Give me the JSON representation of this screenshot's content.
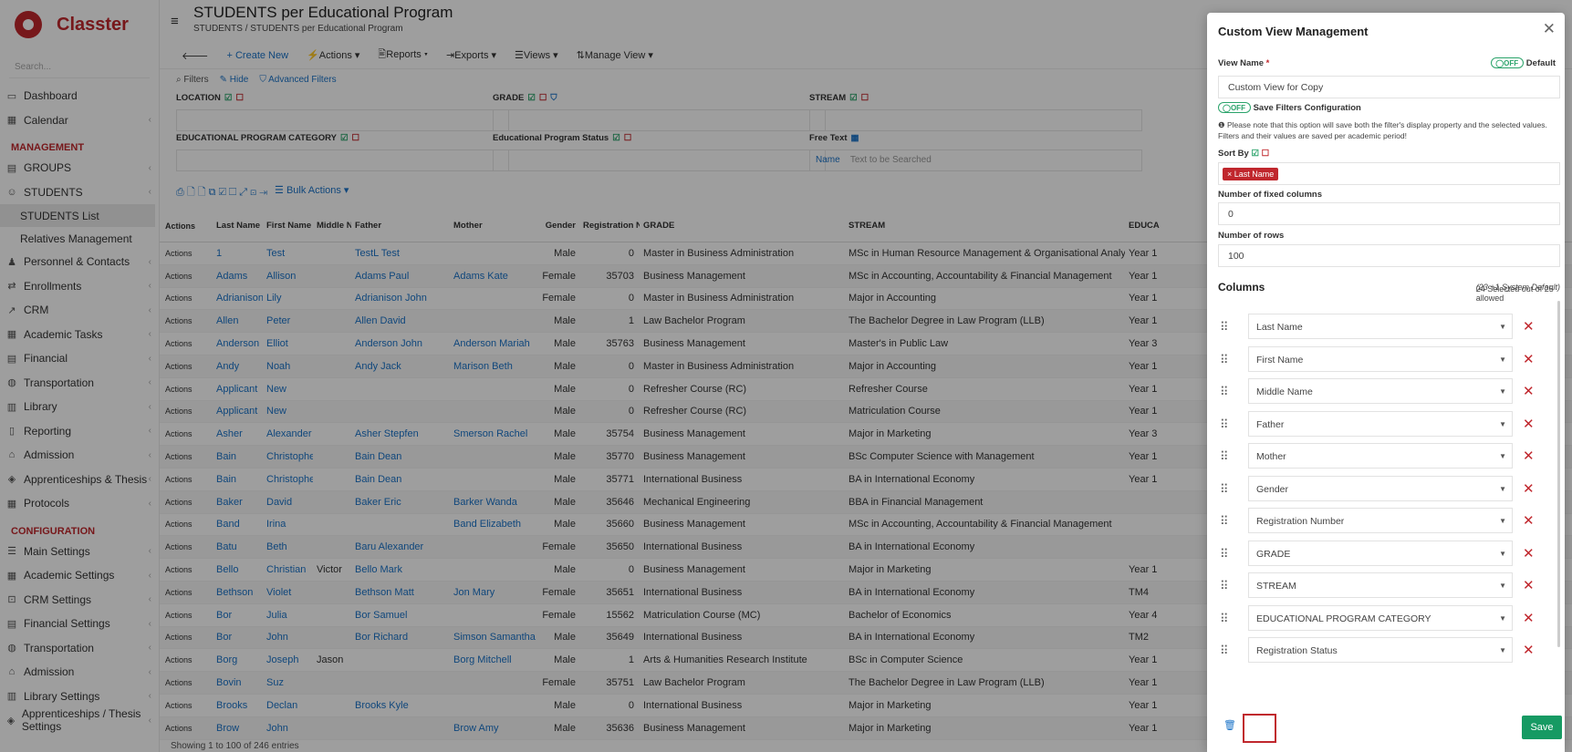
{
  "sidebar": {
    "brand": "Classter",
    "search_placeholder": "Search...",
    "top": [
      {
        "label": "Dashboard",
        "icon": "monitor-icon"
      },
      {
        "label": "Calendar",
        "icon": "calendar-icon"
      }
    ],
    "mgmt_title": "MANAGEMENT",
    "mgmt": [
      {
        "label": "GROUPS",
        "icon": "groups-icon"
      },
      {
        "label": "STUDENTS",
        "icon": "students-icon"
      }
    ],
    "students_sub": [
      {
        "label": "STUDENTS List"
      },
      {
        "label": "Relatives Management"
      }
    ],
    "mgmt2": [
      {
        "label": "Personnel & Contacts",
        "icon": "people-icon"
      },
      {
        "label": "Enrollments",
        "icon": "arrows-icon"
      },
      {
        "label": "CRM",
        "icon": "chart-icon"
      },
      {
        "label": "Academic Tasks",
        "icon": "grid-icon"
      },
      {
        "label": "Financial",
        "icon": "money-icon"
      },
      {
        "label": "Transportation",
        "icon": "bus-icon"
      },
      {
        "label": "Library",
        "icon": "library-icon"
      },
      {
        "label": "Reporting",
        "icon": "report-icon"
      },
      {
        "label": "Admission",
        "icon": "bank-icon"
      },
      {
        "label": "Apprenticeships & Thesis",
        "icon": "cap-icon"
      },
      {
        "label": "Protocols",
        "icon": "protocol-icon"
      }
    ],
    "config_title": "CONFIGURATION",
    "config": [
      {
        "label": "Main Settings",
        "icon": "sliders-icon"
      },
      {
        "label": "Academic Settings",
        "icon": "grid-icon"
      },
      {
        "label": "CRM Settings",
        "icon": "crm-icon"
      },
      {
        "label": "Financial Settings",
        "icon": "money-icon"
      },
      {
        "label": "Transportation",
        "icon": "bus-icon"
      },
      {
        "label": "Admission",
        "icon": "bank-icon"
      },
      {
        "label": "Library Settings",
        "icon": "library-icon"
      },
      {
        "label": "Apprenticeships / Thesis Settings",
        "icon": "cap-icon"
      }
    ]
  },
  "page": {
    "title": "STUDENTS per Educational Program",
    "crumb1": "STUDENTS",
    "crumb_sep": "/",
    "crumb2": "STUDENTS per Educational Program"
  },
  "toolbar": {
    "create": "Create New",
    "actions": "Actions",
    "reports": "Reports",
    "exports": "Exports",
    "views": "Views",
    "manage": "Manage View"
  },
  "filters": {
    "filters": "Filters",
    "hide": "Hide",
    "advanced": "Advanced Filters",
    "location": "LOCATION",
    "grade": "GRADE",
    "stream": "STREAM",
    "epc": "EDUCATIONAL PROGRAM CATEGORY",
    "eps": "Educational Program Status",
    "free": "Free Text",
    "name": "Name",
    "search_ph": "Text to be Searched",
    "bulk": "Bulk Actions"
  },
  "table": {
    "headers": [
      "Actions",
      "Last Name",
      "First Name",
      "Middle Name",
      "Father",
      "Mother",
      "Gender",
      "Registration Number",
      "GRADE",
      "STREAM",
      "EDUCA PROGR CATEG"
    ],
    "rows": [
      [
        "Actions",
        "1",
        "Test",
        "",
        "TestL Test",
        "",
        "Male",
        "0",
        "Master in Business Administration",
        "MSc in Human Resource Management & Organisational Analysis",
        "Year 1"
      ],
      [
        "Actions",
        "Adams",
        "Allison",
        "",
        "Adams Paul",
        "Adams Kate",
        "Female",
        "35703",
        "Business Management",
        "MSc in Accounting, Accountability & Financial Management",
        "Year 1"
      ],
      [
        "Actions",
        "Adrianison",
        "Lily",
        "",
        "Adrianison John",
        "",
        "Female",
        "0",
        "Master in Business Administration",
        "Major in Accounting",
        "Year 1"
      ],
      [
        "Actions",
        "Allen",
        "Peter",
        "",
        "Allen David",
        "",
        "Male",
        "1",
        "Law Bachelor Program",
        "The Bachelor Degree in Law Program (LLB)",
        "Year 1"
      ],
      [
        "Actions",
        "Anderson",
        "Elliot",
        "",
        "Anderson John",
        "Anderson Mariah",
        "Male",
        "35763",
        "Business Management",
        "Master's in Public Law",
        "Year 3"
      ],
      [
        "Actions",
        "Andy",
        "Noah",
        "",
        "Andy Jack",
        "Marison Beth",
        "Male",
        "0",
        "Master in Business Administration",
        "Major in Accounting",
        "Year 1"
      ],
      [
        "Actions",
        "Applicant",
        "New",
        "",
        "",
        "",
        "Male",
        "0",
        "Refresher Course (RC)",
        "Refresher Course",
        "Year 1"
      ],
      [
        "Actions",
        "Applicant",
        "New",
        "",
        "",
        "",
        "Male",
        "0",
        "Refresher Course (RC)",
        "Matriculation Course",
        "Year 1"
      ],
      [
        "Actions",
        "Asher",
        "Alexander",
        "",
        "Asher Stepfen",
        "Smerson Rachel",
        "Male",
        "35754",
        "Business Management",
        "Major in Marketing",
        "Year 3"
      ],
      [
        "Actions",
        "Bain",
        "Christopher",
        "",
        "Bain Dean",
        "",
        "Male",
        "35770",
        "Business Management",
        "BSc Computer Science with Management",
        "Year 1"
      ],
      [
        "Actions",
        "Bain",
        "Christopher",
        "",
        "Bain Dean",
        "",
        "Male",
        "35771",
        "International Business",
        "BA in International Economy",
        "Year 1"
      ],
      [
        "Actions",
        "Baker",
        "David",
        "",
        "Baker Eric",
        "Barker Wanda",
        "Male",
        "35646",
        "Mechanical Engineering",
        "BBA in Financial Management",
        ""
      ],
      [
        "Actions",
        "Band",
        "Irina",
        "",
        "",
        "Band Elizabeth",
        "Male",
        "35660",
        "Business Management",
        "MSc in Accounting, Accountability & Financial Management",
        ""
      ],
      [
        "Actions",
        "Batu",
        "Beth",
        "",
        "Baru Alexander",
        "",
        "Female",
        "35650",
        "International Business",
        "BA in International Economy",
        ""
      ],
      [
        "Actions",
        "Bello",
        "Christian",
        "Victor",
        "Bello Mark",
        "",
        "Male",
        "0",
        "Business Management",
        "Major in Marketing",
        "Year 1"
      ],
      [
        "Actions",
        "Bethson",
        "Violet",
        "",
        "Bethson Matt",
        "Jon Mary",
        "Female",
        "35651",
        "International Business",
        "BA in International Economy",
        "TM4"
      ],
      [
        "Actions",
        "Bor",
        "Julia",
        "",
        "Bor Samuel",
        "",
        "Female",
        "15562",
        "Matriculation Course (MC)",
        "Bachelor of Economics",
        "Year 4"
      ],
      [
        "Actions",
        "Bor",
        "John",
        "",
        "Bor Richard",
        "Simson Samantha",
        "Male",
        "35649",
        "International Business",
        "BA in International Economy",
        "TM2"
      ],
      [
        "Actions",
        "Borg",
        "Joseph",
        "Jason",
        "",
        "Borg Mitchell",
        "Male",
        "1",
        "Arts & Humanities Research Institute",
        "BSc in Computer Science",
        "Year 1"
      ],
      [
        "Actions",
        "Bovin",
        "Suz",
        "",
        "",
        "",
        "Female",
        "35751",
        "Law Bachelor Program",
        "The Bachelor Degree in Law Program (LLB)",
        "Year 1"
      ],
      [
        "Actions",
        "Brooks",
        "Declan",
        "",
        "Brooks Kyle",
        "",
        "Male",
        "0",
        "International Business",
        "Major in Marketing",
        "Year 1"
      ],
      [
        "Actions",
        "Brow",
        "John",
        "",
        "",
        "Brow Amy",
        "Male",
        "35636",
        "Business Management",
        "Major in Marketing",
        "Year 1"
      ]
    ]
  },
  "footer": "Showing 1 to 100 of 246 entries",
  "modal": {
    "title": "Custom View Management",
    "view_name_label": "View Name",
    "required": "*",
    "off": "OFF",
    "default": "Default",
    "view_name_value": "Custom View for Copy",
    "save_filters": "Save Filters Configuration",
    "note": "Please note that this option will save both the filter's display property and the selected values. Filters and their values are saved per academic period!",
    "sort_by": "Sort By",
    "sort_chip": "× Last Name",
    "fixed_label": "Number of fixed columns",
    "fixed_value": "0",
    "rows_label": "Number of rows",
    "rows_value": "100",
    "columns": "Columns",
    "selected_info": "24 Selected out of 25 allowed",
    "selected_extra": "(23 +1 System Default)",
    "cols": [
      "Last Name",
      "First Name",
      "Middle Name",
      "Father",
      "Mother",
      "Gender",
      "Registration Number",
      "GRADE",
      "STREAM",
      "EDUCATIONAL PROGRAM CATEGORY",
      "Registration Status"
    ],
    "save": "Save"
  },
  "colors": {
    "brand": "#c0272d",
    "link": "#1a73c8",
    "save": "#169a63"
  }
}
